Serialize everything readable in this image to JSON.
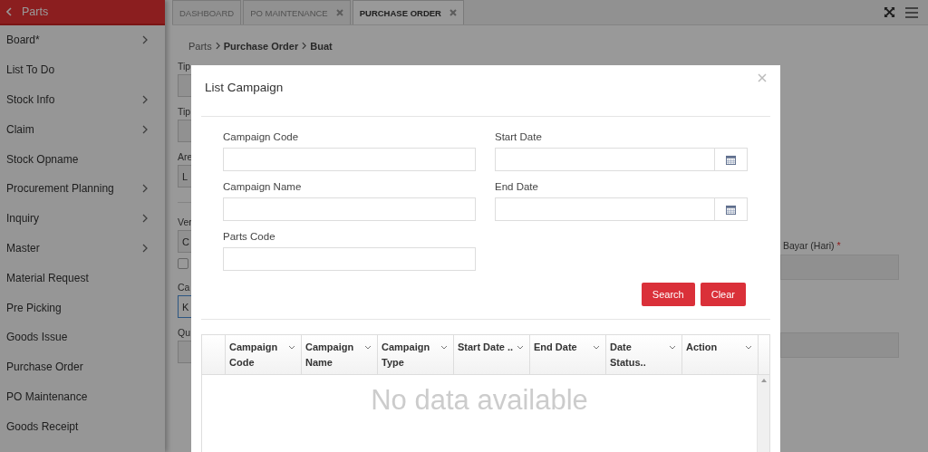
{
  "sidebar": {
    "header": "Parts",
    "items": [
      {
        "label": "Board*",
        "expandable": true
      },
      {
        "label": "List To Do",
        "expandable": false
      },
      {
        "label": "Stock Info",
        "expandable": true
      },
      {
        "label": "Claim",
        "expandable": true
      },
      {
        "label": "Stock Opname",
        "expandable": false
      },
      {
        "label": "Procurement Planning",
        "expandable": true
      },
      {
        "label": "Inquiry",
        "expandable": true
      },
      {
        "label": "Master",
        "expandable": true
      },
      {
        "label": "Material Request",
        "expandable": false
      },
      {
        "label": "Pre Picking",
        "expandable": false
      },
      {
        "label": "Goods Issue",
        "expandable": false
      },
      {
        "label": "Purchase Order",
        "expandable": false
      },
      {
        "label": "PO Maintenance",
        "expandable": false
      },
      {
        "label": "Goods Receipt",
        "expandable": false
      }
    ]
  },
  "tabs": [
    {
      "label": "DASHBOARD",
      "closable": false,
      "selected": false
    },
    {
      "label": "PO MAINTENANCE",
      "closable": true,
      "selected": false
    },
    {
      "label": "PURCHASE ORDER",
      "closable": true,
      "selected": true
    }
  ],
  "breadcrumb": [
    "Parts",
    "Purchase Order",
    "Buat"
  ],
  "form": {
    "left": [
      {
        "kind": "field",
        "label": "Tip",
        "focused": false
      },
      {
        "kind": "field",
        "label": "Tip",
        "focused": false
      },
      {
        "kind": "field",
        "label": "Are",
        "value": "L",
        "focused": false
      },
      {
        "kind": "divider"
      },
      {
        "kind": "field",
        "label": "Ver",
        "value": "C",
        "focused": false
      },
      {
        "kind": "checkbox",
        "checked": false
      },
      {
        "kind": "field",
        "label": "Ca",
        "value": "K",
        "focused": true
      },
      {
        "kind": "field",
        "label": "Qu",
        "focused": false
      }
    ],
    "right": {
      "label": "Bayar (Hari)",
      "required_mark": "*"
    }
  },
  "modal": {
    "title": "List Campaign",
    "fields": [
      {
        "label": "Campaign Code",
        "kind": "text"
      },
      {
        "label": "Start Date",
        "kind": "date"
      },
      {
        "label": "Campaign Name",
        "kind": "text"
      },
      {
        "label": "End Date",
        "kind": "date"
      },
      {
        "label": "Parts Code",
        "kind": "text"
      }
    ],
    "buttons": [
      "Search",
      "Clear"
    ],
    "table": {
      "columns": [
        "Campaign Code",
        "Campaign Name",
        "Campaign Type",
        "Start Date ..",
        "End Date",
        "Date Status..",
        "Action"
      ],
      "empty_text": "No data available"
    }
  }
}
